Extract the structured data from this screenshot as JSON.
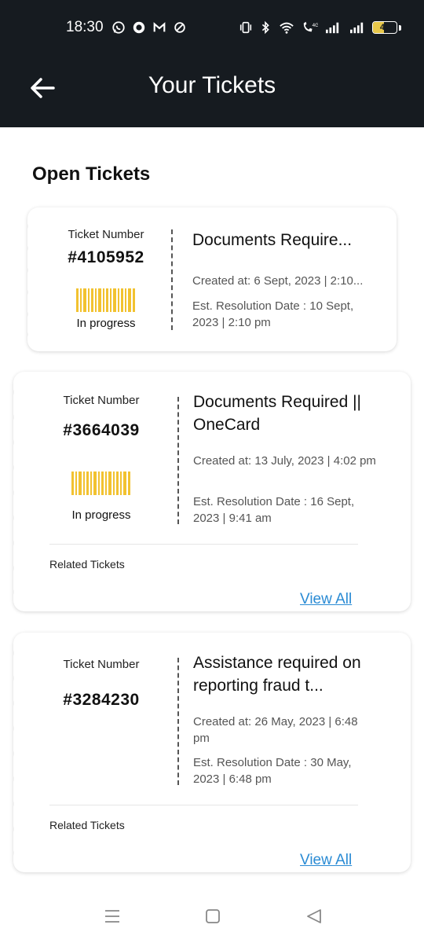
{
  "status_bar": {
    "time": "18:30",
    "battery": "46",
    "left_icons": [
      "whatsapp-icon",
      "circle-app-icon",
      "gmail-icon",
      "nosync-icon"
    ],
    "right_icons": [
      "vibrate-icon",
      "bluetooth-icon",
      "wifi-icon",
      "volte-call-icon",
      "signal-icon",
      "signal-icon",
      "battery-icon"
    ]
  },
  "header": {
    "title": "Your Tickets",
    "back_icon": "arrow-left-icon",
    "background": "#161b20"
  },
  "section": {
    "title": "Open Tickets"
  },
  "tickets": [
    {
      "number_label": "Ticket Number",
      "number": "#4105952",
      "status": "In progress",
      "title": "Documents Require...",
      "created": "Created at: 6 Sept, 2023 | 2:10...",
      "resolution": "Est. Resolution Date : 10 Sept, 2023 | 2:10 pm"
    },
    {
      "number_label": "Ticket Number",
      "number": "#3664039",
      "status": "In progress",
      "title": "Documents Required || OneCard",
      "created": "Created at: 13 July, 2023 | 4:02 pm",
      "resolution": "Est. Resolution Date : 16 Sept, 2023 | 9:41 am",
      "related_label": "Related Tickets",
      "view_all": "View All"
    },
    {
      "number_label": "Ticket Number",
      "number": "#3284230",
      "title": "Assistance required on reporting fraud t...",
      "created": "Created at: 26 May, 2023 | 6:48 pm",
      "resolution": "Est. Resolution Date : 30 May, 2023 | 6:48 pm",
      "related_label": "Related Tickets",
      "view_all": "View All"
    }
  ],
  "colors": {
    "barcode": "#f2c230",
    "link": "#2a8bd4"
  },
  "nav_bar": {
    "icons": [
      "menu-icon",
      "home-square-icon",
      "back-triangle-icon"
    ]
  }
}
